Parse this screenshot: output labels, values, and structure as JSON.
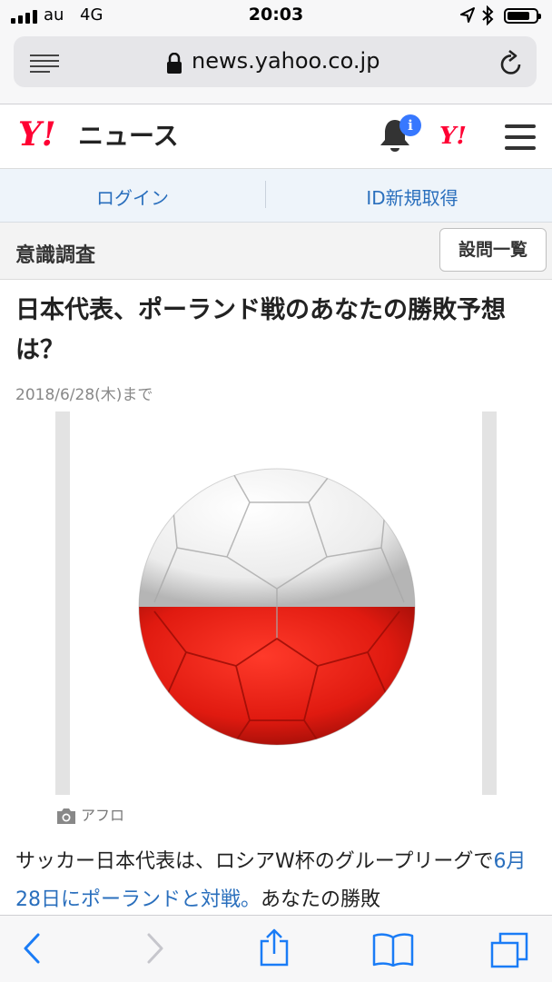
{
  "status_bar": {
    "carrier": "au",
    "network": "4G",
    "time": "20:03",
    "battery_level": 0.8
  },
  "browser": {
    "url": "news.yahoo.co.jp",
    "icons": [
      "reader-icon",
      "lock-icon",
      "reload-icon"
    ]
  },
  "header": {
    "logo": "Y!",
    "logo_text": "ニュース",
    "notification_badge": "i",
    "yahoo_logo": "Y!",
    "icons": [
      "bell-icon",
      "menu-icon"
    ]
  },
  "auth": {
    "login": "ログイン",
    "register": "ID新規取得"
  },
  "section": {
    "title": "意識調査",
    "list_button": "設問一覧"
  },
  "article": {
    "title": "日本代表、ポーランド戦のあなたの勝敗予想は？",
    "deadline": "2018/6/28(木)まで",
    "photo_credit": "アフロ",
    "body_before": "サッカー日本代表は、ロシアW杯のグループリーグで",
    "body_link": "6月28日にポーランドと対戦。",
    "body_after": "あなたの勝敗"
  },
  "toolbar": {
    "items": [
      "back-icon",
      "forward-icon",
      "share-icon",
      "bookmarks-icon",
      "tabs-icon"
    ]
  },
  "colors": {
    "yahoo_red": "#ff0033",
    "link_blue": "#2a6fbd",
    "ios_blue": "#1a7cf6",
    "badge_blue": "#3778ff"
  }
}
